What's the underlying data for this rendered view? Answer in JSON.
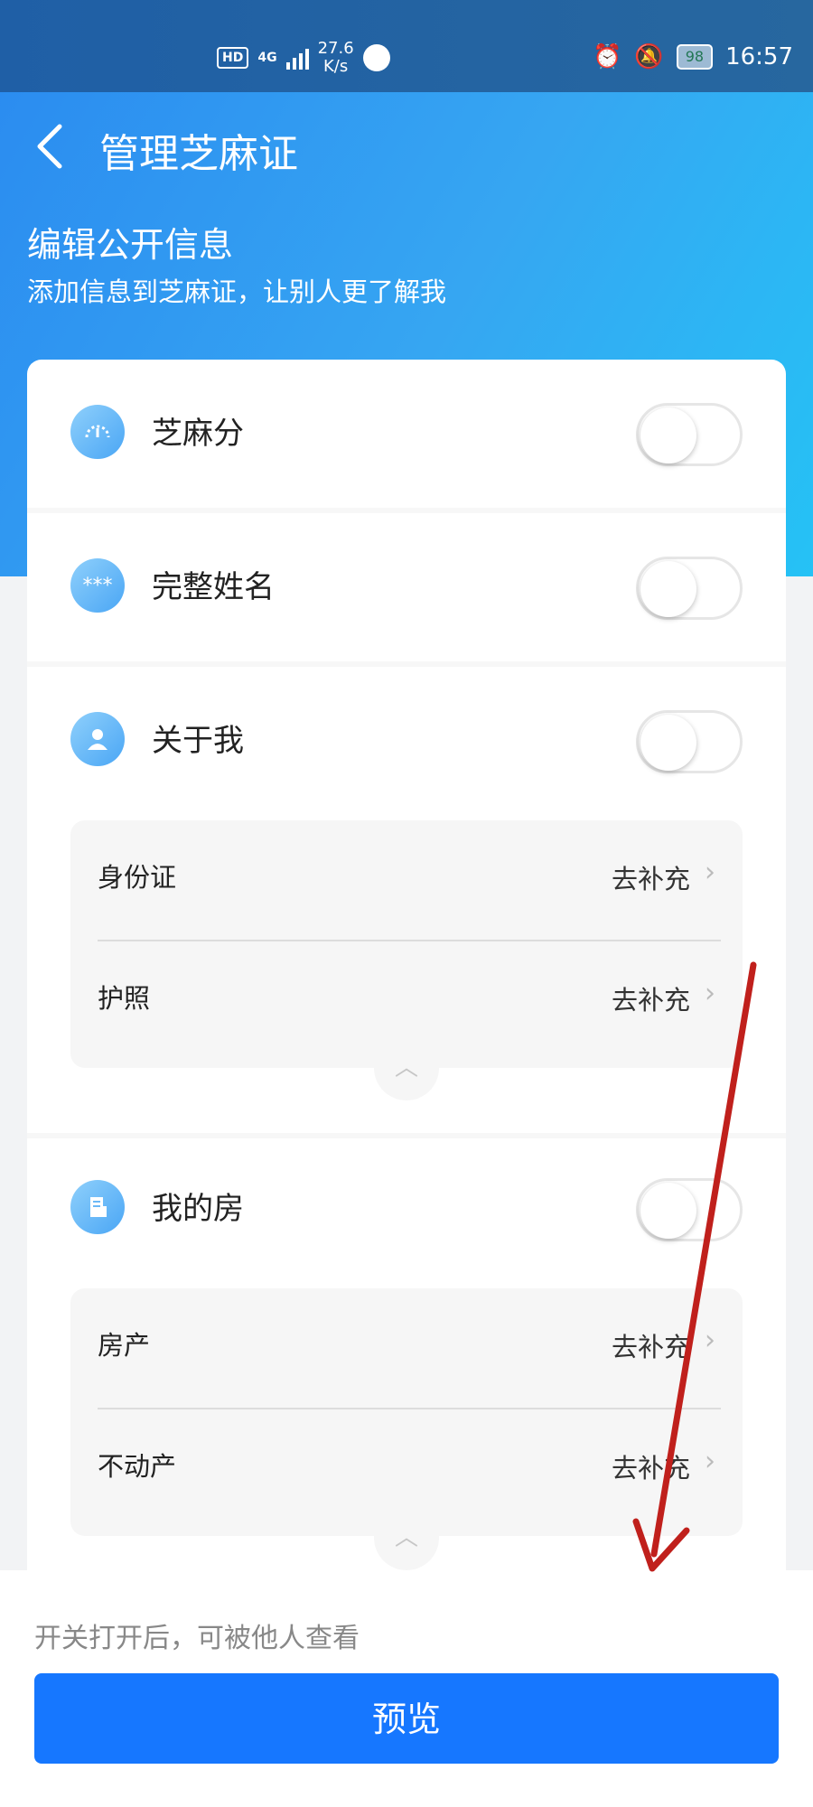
{
  "status_bar": {
    "hd": "HD",
    "network": "4G",
    "speed_value": "27.6",
    "speed_unit": "K/s",
    "battery": "98",
    "time": "16:57"
  },
  "nav": {
    "title": "管理芝麻证",
    "back_icon": "chevron-left-icon"
  },
  "header": {
    "title": "编辑公开信息",
    "subtitle": "添加信息到芝麻证，让别人更了解我"
  },
  "sections": [
    {
      "label": "芝麻分",
      "icon": "gauge-icon",
      "enabled": false
    },
    {
      "label": "完整姓名",
      "icon": "masked-name-icon",
      "icon_text": "***",
      "enabled": false
    },
    {
      "label": "关于我",
      "icon": "person-icon",
      "enabled": false,
      "items": [
        {
          "label": "身份证",
          "action": "去补充"
        },
        {
          "label": "护照",
          "action": "去补充"
        }
      ]
    },
    {
      "label": "我的房",
      "icon": "building-icon",
      "enabled": false,
      "items": [
        {
          "label": "房产",
          "action": "去补充"
        },
        {
          "label": "不动产",
          "action": "去补充"
        }
      ]
    }
  ],
  "footer": {
    "hint": "开关打开后，可被他人查看",
    "button": "预览"
  },
  "colors": {
    "accent": "#1677ff",
    "header_gradient_start": "#2a8af0",
    "header_gradient_end": "#25c2f5",
    "annotation_arrow": "#c0201c"
  }
}
